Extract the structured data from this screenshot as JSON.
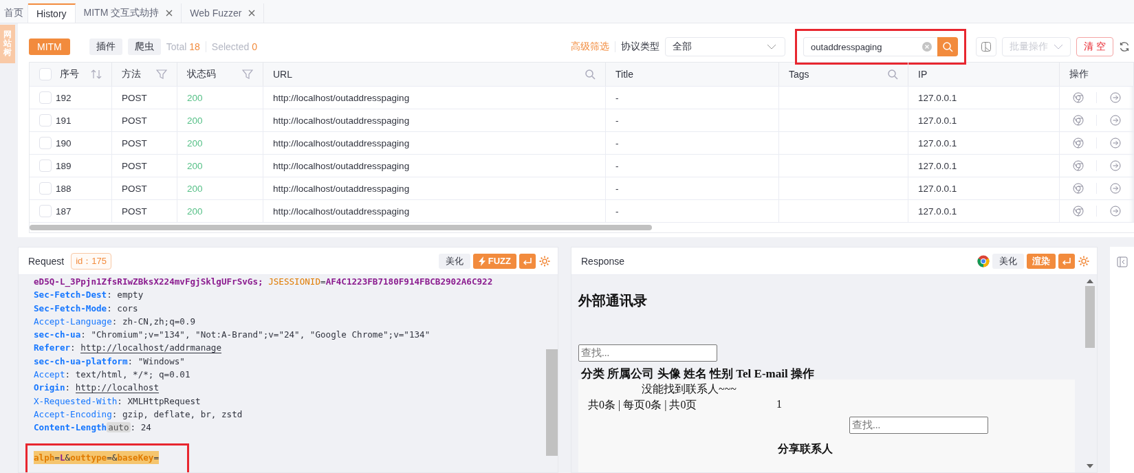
{
  "tabs": [
    {
      "label": "首页",
      "closable": false,
      "selected": false
    },
    {
      "label": "History",
      "closable": false,
      "selected": true
    },
    {
      "label": "MITM 交互式劫持",
      "closable": true,
      "selected": false
    },
    {
      "label": "Web Fuzzer",
      "closable": true,
      "selected": false
    }
  ],
  "side_tab": "网站树",
  "toolbar": {
    "sources": [
      {
        "label": "MITM",
        "selected": true
      },
      {
        "label": "插件",
        "selected": false
      },
      {
        "label": "爬虫",
        "selected": false
      }
    ],
    "total_label": "Total",
    "total": "18",
    "selected_label": "Selected",
    "selected_count": "0",
    "advanced_filter": "高级筛选",
    "protocol_label": "协议类型",
    "protocol_value": "全部",
    "search": {
      "value": "outaddresspaging",
      "highlighted": true
    },
    "batch": {
      "label": "批量操作",
      "disabled": true
    },
    "clear": "清 空"
  },
  "table": {
    "columns": [
      {
        "label": "序号",
        "kind": "sortable",
        "checked": false
      },
      {
        "label": "方法",
        "kind": "filterable"
      },
      {
        "label": "状态码",
        "kind": "filterable"
      },
      {
        "label": "URL",
        "kind": "searchable"
      },
      {
        "label": "Title",
        "kind": "plain"
      },
      {
        "label": "Tags",
        "kind": "searchable"
      },
      {
        "label": "IP",
        "kind": "plain"
      },
      {
        "label": "操作",
        "kind": "plain"
      }
    ],
    "rows": [
      {
        "checked": false,
        "cells": [
          "192",
          "POST",
          "200",
          "http://localhost/outaddresspaging",
          "-",
          "",
          "127.0.0.1"
        ]
      },
      {
        "checked": false,
        "cells": [
          "191",
          "POST",
          "200",
          "http://localhost/outaddresspaging",
          "-",
          "",
          "127.0.0.1"
        ]
      },
      {
        "checked": false,
        "cells": [
          "190",
          "POST",
          "200",
          "http://localhost/outaddresspaging",
          "-",
          "",
          "127.0.0.1"
        ]
      },
      {
        "checked": false,
        "cells": [
          "189",
          "POST",
          "200",
          "http://localhost/outaddresspaging",
          "-",
          "",
          "127.0.0.1"
        ]
      },
      {
        "checked": false,
        "cells": [
          "188",
          "POST",
          "200",
          "http://localhost/outaddresspaging",
          "-",
          "",
          "127.0.0.1"
        ]
      },
      {
        "checked": false,
        "cells": [
          "187",
          "POST",
          "200",
          "http://localhost/outaddresspaging",
          "-",
          "",
          "127.0.0.1"
        ]
      }
    ]
  },
  "request": {
    "title": "Request",
    "id_badge": "id：175",
    "beautify": "美化",
    "fuzz": "FUZZ",
    "lines": [
      [
        {
          "kind": "cookie",
          "text": "eD5Q-L_3Ppjn1ZfsRIwZBksX224mvFgjSklgUFrSvGs;"
        },
        {
          "kind": "cookie-key",
          "text": " JSESSIONID"
        },
        {
          "kind": "punct",
          "text": "="
        },
        {
          "kind": "cookie",
          "text": "AF4C1223FB7180F914FBCB2902A6C922"
        }
      ],
      [
        {
          "kind": "key",
          "text": "Sec-Fetch-Dest"
        },
        {
          "kind": "punct",
          "text": ": "
        },
        {
          "kind": "value",
          "text": "empty"
        }
      ],
      [
        {
          "kind": "key",
          "text": "Sec-Fetch-Mode"
        },
        {
          "kind": "punct",
          "text": ": "
        },
        {
          "kind": "value",
          "text": "cors"
        }
      ],
      [
        {
          "kind": "key-light",
          "text": "Accept-Language"
        },
        {
          "kind": "punct",
          "text": ": "
        },
        {
          "kind": "value",
          "text": "zh-CN,zh;q=0.9"
        }
      ],
      [
        {
          "kind": "key",
          "text": "sec-ch-ua"
        },
        {
          "kind": "punct",
          "text": ": "
        },
        {
          "kind": "value",
          "text": "\"Chromium\";v=\"134\", \"Not:A-Brand\";v=\"24\", \"Google Chrome\";v=\"134\""
        }
      ],
      [
        {
          "kind": "key",
          "text": "Referer"
        },
        {
          "kind": "punct",
          "text": ": "
        },
        {
          "kind": "link",
          "text": "http://localhost/addrmanage"
        }
      ],
      [
        {
          "kind": "key",
          "text": "sec-ch-ua-platform"
        },
        {
          "kind": "punct",
          "text": ": "
        },
        {
          "kind": "value",
          "text": "\"Windows\""
        }
      ],
      [
        {
          "kind": "key-light",
          "text": "Accept"
        },
        {
          "kind": "punct",
          "text": ": "
        },
        {
          "kind": "value",
          "text": "text/html, */*; q=0.01"
        }
      ],
      [
        {
          "kind": "key",
          "text": "Origin"
        },
        {
          "kind": "punct",
          "text": ": "
        },
        {
          "kind": "link",
          "text": "http://localhost"
        }
      ],
      [
        {
          "kind": "key-light",
          "text": "X-Requested-With"
        },
        {
          "kind": "punct",
          "text": ": "
        },
        {
          "kind": "value",
          "text": "XMLHttpRequest"
        }
      ],
      [
        {
          "kind": "key-light",
          "text": "Accept-Encoding"
        },
        {
          "kind": "punct",
          "text": ": "
        },
        {
          "kind": "value",
          "text": "gzip, deflate, br, zstd"
        }
      ],
      [
        {
          "kind": "key",
          "text": "Content-Length"
        },
        {
          "kind": "auto",
          "text": "auto"
        },
        {
          "kind": "punct",
          "text": ": "
        },
        {
          "kind": "value",
          "text": "24"
        }
      ]
    ],
    "body": [
      {
        "kind": "body-key",
        "text": "alph"
      },
      {
        "kind": "punct",
        "text": "="
      },
      {
        "kind": "body-value",
        "text": "L"
      },
      {
        "kind": "punct",
        "text": "&"
      },
      {
        "kind": "body-key",
        "text": "outtype"
      },
      {
        "kind": "punct",
        "text": "=&"
      },
      {
        "kind": "body-key",
        "text": "baseKey"
      },
      {
        "kind": "punct",
        "text": "="
      }
    ],
    "body_highlighted": true
  },
  "response": {
    "title": "Response",
    "beautify": "美化",
    "render": "渲染",
    "render_selected": true,
    "page": {
      "heading": "外部通讯录",
      "search_placeholder": "查找...",
      "table_header": "分类 所属公司 头像 姓名 性别 Tel E-mail 操作",
      "empty_text": "没能找到联系人~~~",
      "pagination": "共0条 | 每页0条 | 共0页",
      "page_number": "1",
      "share_search_placeholder": "查找...",
      "share_heading": "分享联系人"
    }
  }
}
